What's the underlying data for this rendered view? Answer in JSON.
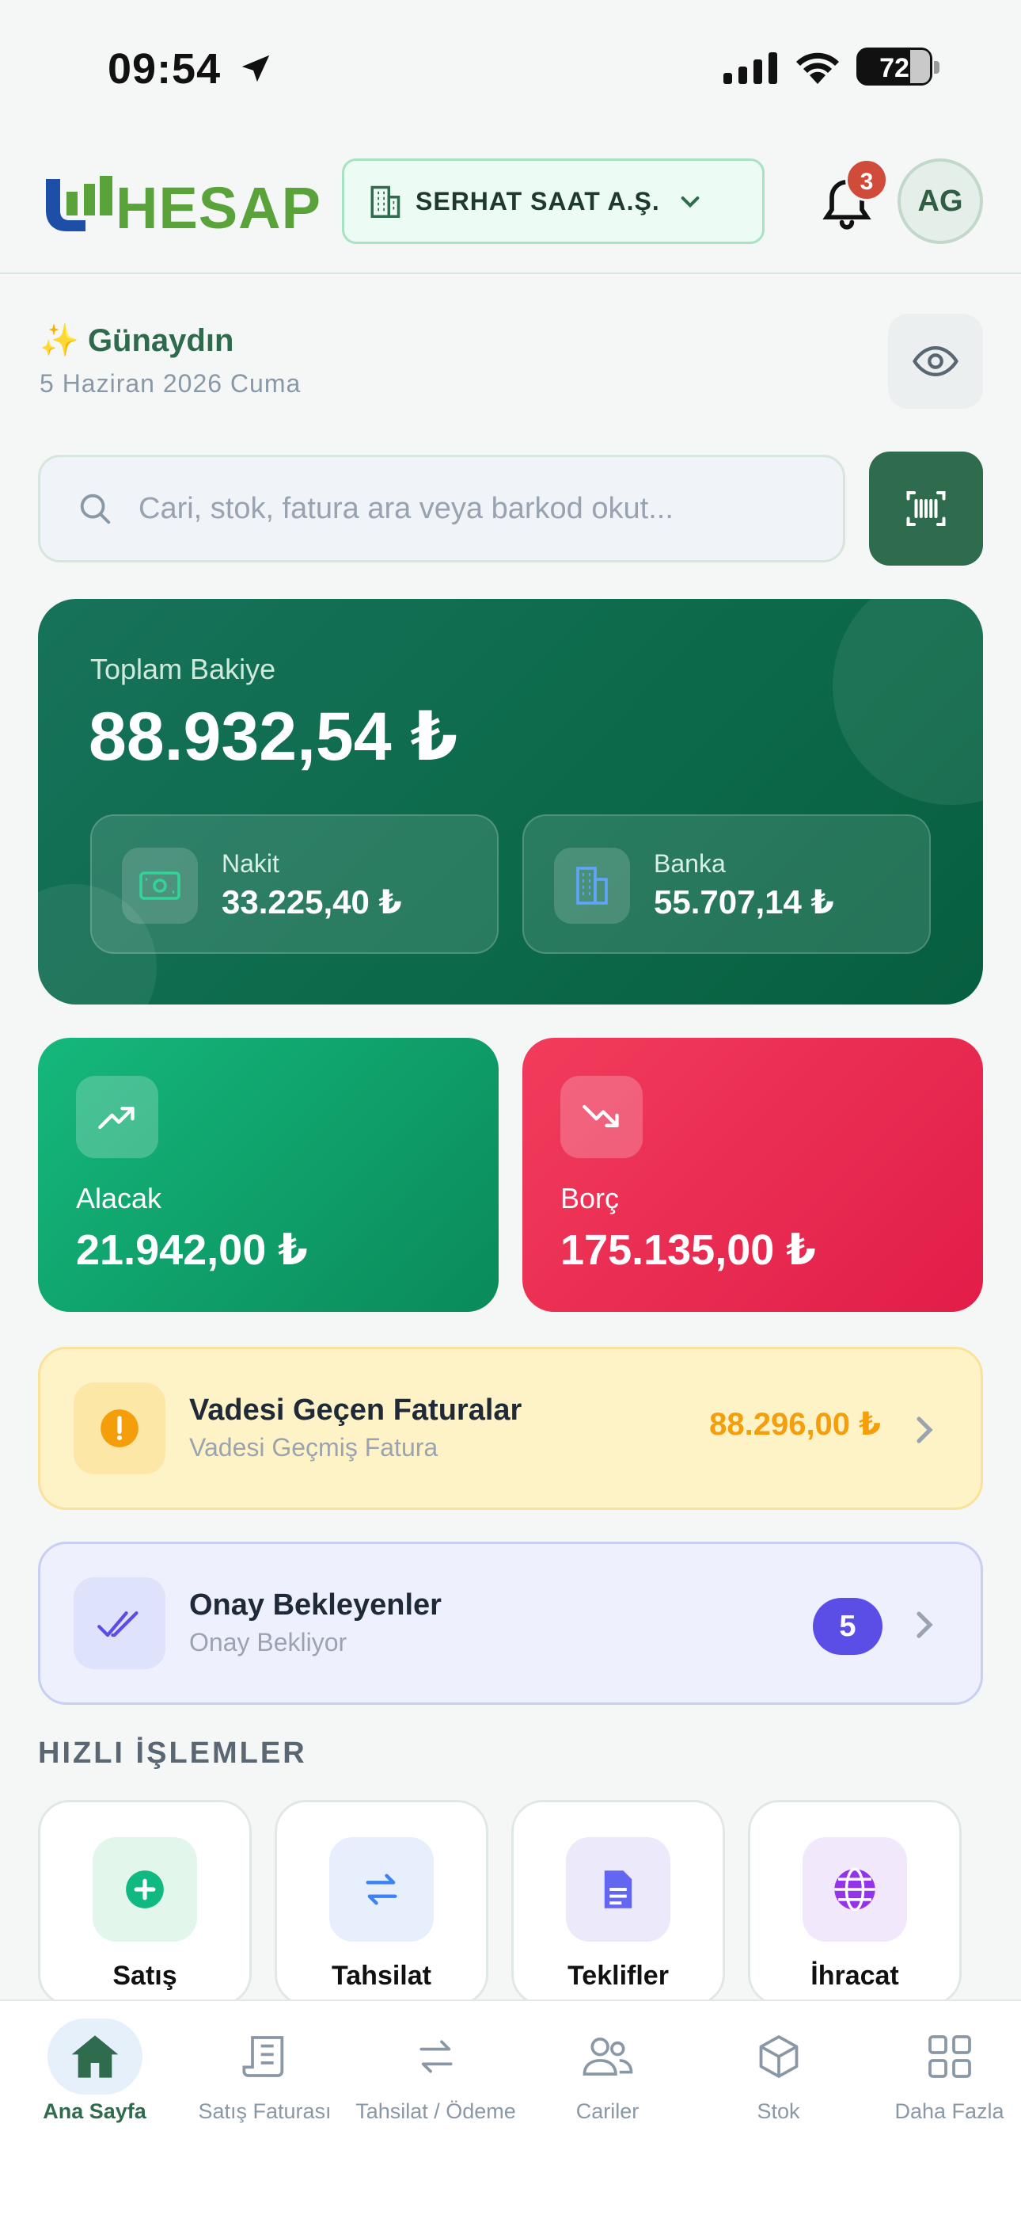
{
  "status_bar": {
    "time": "09:54",
    "battery": "72"
  },
  "header": {
    "logo_text": "HESAP",
    "company": "SERHAT SAAT A.Ş.",
    "notification_count": "3",
    "avatar_initials": "AG"
  },
  "greeting": {
    "emoji": "✨",
    "text": "Günaydın",
    "date": "5 Haziran 2026 Cuma"
  },
  "search": {
    "placeholder": "Cari, stok, fatura ara veya barkod okut..."
  },
  "balance": {
    "label": "Toplam Bakiye",
    "value": "88.932,54 ₺",
    "cash": {
      "label": "Nakit",
      "value": "33.225,40 ₺"
    },
    "bank": {
      "label": "Banka",
      "value": "55.707,14 ₺"
    }
  },
  "receivable": {
    "label": "Alacak",
    "value": "21.942,00 ₺"
  },
  "debt": {
    "label": "Borç",
    "value": "175.135,00 ₺"
  },
  "overdue": {
    "title": "Vadesi Geçen Faturalar",
    "subtitle": "Vadesi Geçmiş Fatura",
    "amount": "88.296,00 ₺"
  },
  "approvals": {
    "title": "Onay Bekleyenler",
    "subtitle": "Onay Bekliyor",
    "count": "5"
  },
  "quick_actions": {
    "title": "HIZLI İŞLEMLER",
    "items": [
      {
        "label": "Satış",
        "icon": "plus-circle-icon"
      },
      {
        "label": "Tahsilat",
        "icon": "swap-icon"
      },
      {
        "label": "Teklifler",
        "icon": "document-icon"
      },
      {
        "label": "İhracat",
        "icon": "globe-icon"
      }
    ]
  },
  "tabs": [
    {
      "label": "Ana Sayfa",
      "icon": "home-icon",
      "active": true
    },
    {
      "label": "Satış Faturası",
      "icon": "receipt-icon"
    },
    {
      "label": "Tahsilat / Ödeme",
      "icon": "swap-icon"
    },
    {
      "label": "Cariler",
      "icon": "users-icon"
    },
    {
      "label": "Stok",
      "icon": "box-icon"
    },
    {
      "label": "Daha Fazla",
      "icon": "grid-icon"
    }
  ],
  "colors": {
    "brand": "#2f6b4d",
    "receivable": "#10b981",
    "debt": "#e11d48",
    "warning": "#f59e0b",
    "accent": "#5b4ee6"
  }
}
